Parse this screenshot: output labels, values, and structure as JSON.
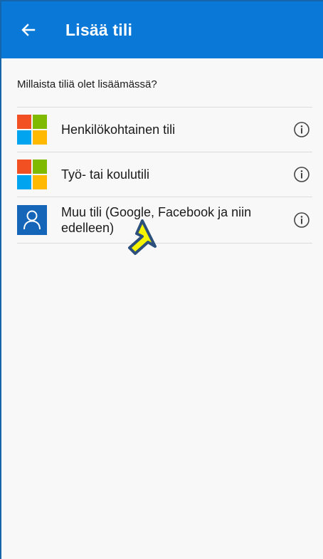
{
  "header": {
    "title": "Lisää tili",
    "back_icon": "arrow-left-icon"
  },
  "prompt": "Millaista tiliä olet lisäämässä?",
  "accounts": [
    {
      "label": "Henkilökohtainen tili",
      "icon": "microsoft-logo-icon"
    },
    {
      "label": "Työ- tai koulutili",
      "icon": "microsoft-logo-icon"
    },
    {
      "label": "Muu tili (Google, Facebook ja niin edelleen)",
      "icon": "user-icon"
    }
  ],
  "colors": {
    "app_bar": "#0a78d7",
    "ms_red": "#f25022",
    "ms_green": "#7fba00",
    "ms_blue": "#00a4ef",
    "ms_yellow": "#ffb900",
    "user_icon_bg": "#1565b8",
    "pointer_fill": "#f5f500",
    "pointer_stroke": "#2d4f7c"
  },
  "annotation": {
    "icon": "pointer-arrow-icon"
  }
}
